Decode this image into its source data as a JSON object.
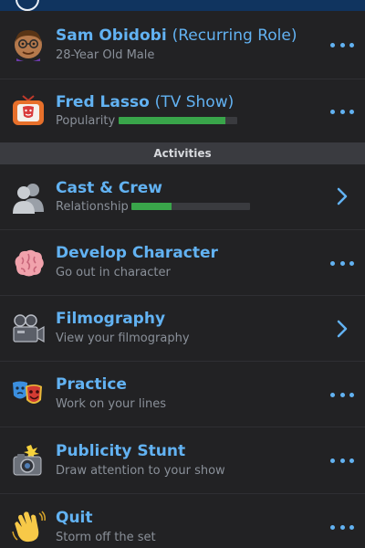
{
  "header": {},
  "character": {
    "name": "Sam Obidobi",
    "role": "(Recurring Role)",
    "description": "28-Year Old Male",
    "icon": "avatar-icon"
  },
  "show": {
    "name": "Fred Lasso",
    "type": "(TV Show)",
    "stat_label": "Popularity",
    "popularity_level": 0.9,
    "bar_color": "#39a54a",
    "icon": "tv-show-icon"
  },
  "section_title": "Activities",
  "activities": [
    {
      "title": "Cast & Crew",
      "subtitle": "Relationship",
      "relationship_level": 0.34,
      "icon": "people-silhouette-icon",
      "action": "chevron"
    },
    {
      "title": "Develop Character",
      "subtitle": "Go out in character",
      "icon": "brain-icon",
      "action": "more"
    },
    {
      "title": "Filmography",
      "subtitle": "View your filmography",
      "icon": "film-camera-icon",
      "action": "chevron"
    },
    {
      "title": "Practice",
      "subtitle": "Work on your lines",
      "icon": "theater-masks-icon",
      "action": "more"
    },
    {
      "title": "Publicity Stunt",
      "subtitle": "Draw attention to your show",
      "icon": "camera-flash-icon",
      "action": "more"
    },
    {
      "title": "Quit",
      "subtitle": "Storm off the set",
      "icon": "waving-hand-icon",
      "action": "more"
    }
  ],
  "colors": {
    "accent": "#62b2f2",
    "background": "#222224",
    "header": "#10345f",
    "section": "#3a3b40",
    "progress": "#39a54a"
  }
}
